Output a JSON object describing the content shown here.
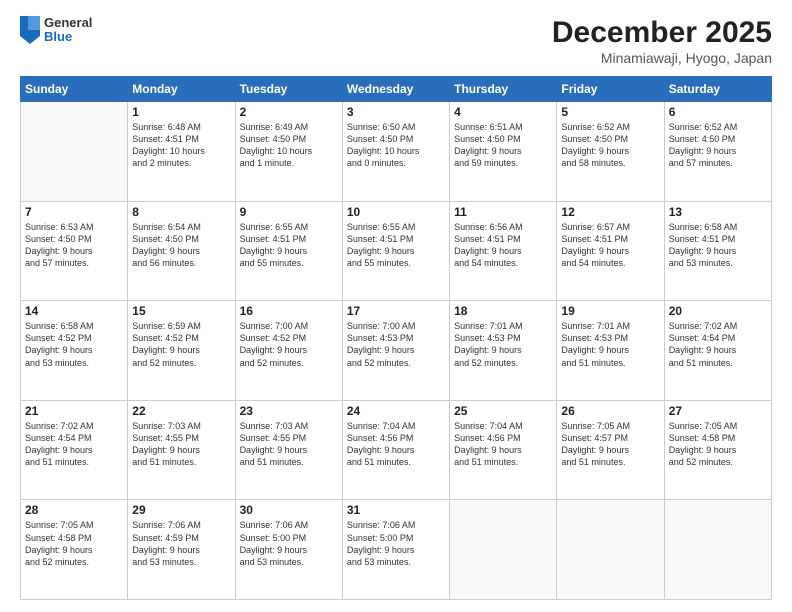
{
  "header": {
    "logo": {
      "general": "General",
      "blue": "Blue"
    },
    "title": "December 2025",
    "subtitle": "Minamiawaji, Hyogo, Japan"
  },
  "calendar": {
    "days_of_week": [
      "Sunday",
      "Monday",
      "Tuesday",
      "Wednesday",
      "Thursday",
      "Friday",
      "Saturday"
    ],
    "rows": [
      [
        {
          "day": "",
          "info": ""
        },
        {
          "day": "1",
          "info": "Sunrise: 6:48 AM\nSunset: 4:51 PM\nDaylight: 10 hours\nand 2 minutes."
        },
        {
          "day": "2",
          "info": "Sunrise: 6:49 AM\nSunset: 4:50 PM\nDaylight: 10 hours\nand 1 minute."
        },
        {
          "day": "3",
          "info": "Sunrise: 6:50 AM\nSunset: 4:50 PM\nDaylight: 10 hours\nand 0 minutes."
        },
        {
          "day": "4",
          "info": "Sunrise: 6:51 AM\nSunset: 4:50 PM\nDaylight: 9 hours\nand 59 minutes."
        },
        {
          "day": "5",
          "info": "Sunrise: 6:52 AM\nSunset: 4:50 PM\nDaylight: 9 hours\nand 58 minutes."
        },
        {
          "day": "6",
          "info": "Sunrise: 6:52 AM\nSunset: 4:50 PM\nDaylight: 9 hours\nand 57 minutes."
        }
      ],
      [
        {
          "day": "7",
          "info": "Sunrise: 6:53 AM\nSunset: 4:50 PM\nDaylight: 9 hours\nand 57 minutes."
        },
        {
          "day": "8",
          "info": "Sunrise: 6:54 AM\nSunset: 4:50 PM\nDaylight: 9 hours\nand 56 minutes."
        },
        {
          "day": "9",
          "info": "Sunrise: 6:55 AM\nSunset: 4:51 PM\nDaylight: 9 hours\nand 55 minutes."
        },
        {
          "day": "10",
          "info": "Sunrise: 6:55 AM\nSunset: 4:51 PM\nDaylight: 9 hours\nand 55 minutes."
        },
        {
          "day": "11",
          "info": "Sunrise: 6:56 AM\nSunset: 4:51 PM\nDaylight: 9 hours\nand 54 minutes."
        },
        {
          "day": "12",
          "info": "Sunrise: 6:57 AM\nSunset: 4:51 PM\nDaylight: 9 hours\nand 54 minutes."
        },
        {
          "day": "13",
          "info": "Sunrise: 6:58 AM\nSunset: 4:51 PM\nDaylight: 9 hours\nand 53 minutes."
        }
      ],
      [
        {
          "day": "14",
          "info": "Sunrise: 6:58 AM\nSunset: 4:52 PM\nDaylight: 9 hours\nand 53 minutes."
        },
        {
          "day": "15",
          "info": "Sunrise: 6:59 AM\nSunset: 4:52 PM\nDaylight: 9 hours\nand 52 minutes."
        },
        {
          "day": "16",
          "info": "Sunrise: 7:00 AM\nSunset: 4:52 PM\nDaylight: 9 hours\nand 52 minutes."
        },
        {
          "day": "17",
          "info": "Sunrise: 7:00 AM\nSunset: 4:53 PM\nDaylight: 9 hours\nand 52 minutes."
        },
        {
          "day": "18",
          "info": "Sunrise: 7:01 AM\nSunset: 4:53 PM\nDaylight: 9 hours\nand 52 minutes."
        },
        {
          "day": "19",
          "info": "Sunrise: 7:01 AM\nSunset: 4:53 PM\nDaylight: 9 hours\nand 51 minutes."
        },
        {
          "day": "20",
          "info": "Sunrise: 7:02 AM\nSunset: 4:54 PM\nDaylight: 9 hours\nand 51 minutes."
        }
      ],
      [
        {
          "day": "21",
          "info": "Sunrise: 7:02 AM\nSunset: 4:54 PM\nDaylight: 9 hours\nand 51 minutes."
        },
        {
          "day": "22",
          "info": "Sunrise: 7:03 AM\nSunset: 4:55 PM\nDaylight: 9 hours\nand 51 minutes."
        },
        {
          "day": "23",
          "info": "Sunrise: 7:03 AM\nSunset: 4:55 PM\nDaylight: 9 hours\nand 51 minutes."
        },
        {
          "day": "24",
          "info": "Sunrise: 7:04 AM\nSunset: 4:56 PM\nDaylight: 9 hours\nand 51 minutes."
        },
        {
          "day": "25",
          "info": "Sunrise: 7:04 AM\nSunset: 4:56 PM\nDaylight: 9 hours\nand 51 minutes."
        },
        {
          "day": "26",
          "info": "Sunrise: 7:05 AM\nSunset: 4:57 PM\nDaylight: 9 hours\nand 51 minutes."
        },
        {
          "day": "27",
          "info": "Sunrise: 7:05 AM\nSunset: 4:58 PM\nDaylight: 9 hours\nand 52 minutes."
        }
      ],
      [
        {
          "day": "28",
          "info": "Sunrise: 7:05 AM\nSunset: 4:58 PM\nDaylight: 9 hours\nand 52 minutes."
        },
        {
          "day": "29",
          "info": "Sunrise: 7:06 AM\nSunset: 4:59 PM\nDaylight: 9 hours\nand 53 minutes."
        },
        {
          "day": "30",
          "info": "Sunrise: 7:06 AM\nSunset: 5:00 PM\nDaylight: 9 hours\nand 53 minutes."
        },
        {
          "day": "31",
          "info": "Sunrise: 7:06 AM\nSunset: 5:00 PM\nDaylight: 9 hours\nand 53 minutes."
        },
        {
          "day": "",
          "info": ""
        },
        {
          "day": "",
          "info": ""
        },
        {
          "day": "",
          "info": ""
        }
      ]
    ]
  }
}
